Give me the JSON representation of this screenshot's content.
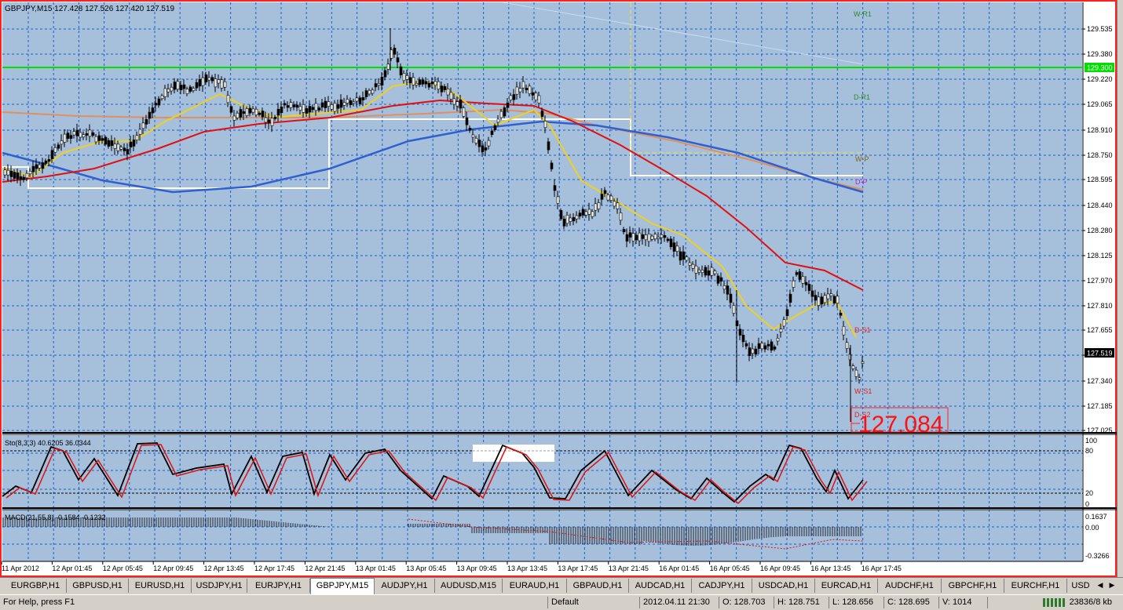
{
  "chart": {
    "header": "GBPJPY,M15  127.428 127.526 127.420 127.519",
    "big_price": "127.084",
    "price_axis": [
      "129.535",
      "129.380",
      "129.220",
      "129.065",
      "128.910",
      "128.750",
      "128.595",
      "128.440",
      "128.280",
      "128.125",
      "127.970",
      "127.810",
      "127.655",
      "127.500",
      "127.340",
      "127.185",
      "127.025"
    ],
    "highlight_green": "129.300",
    "highlight_current": "127.519",
    "time_axis": [
      "11 Apr 2012",
      "12 Apr 01:45",
      "12 Apr 05:45",
      "12 Apr 09:45",
      "12 Apr 13:45",
      "12 Apr 17:45",
      "12 Apr 21:45",
      "13 Apr 01:45",
      "13 Apr 05:45",
      "13 Apr 09:45",
      "13 Apr 13:45",
      "13 Apr 17:45",
      "13 Apr 21:45",
      "16 Apr 01:45",
      "16 Apr 05:45",
      "16 Apr 09:45",
      "16 Apr 13:45",
      "16 Apr 17:45"
    ],
    "pivot_labels": [
      "W-R1",
      "D-R1",
      "W-P",
      "D-P",
      "D-S1",
      "W-S1",
      "D-S2"
    ],
    "colors": {
      "background": "#a6bfdb",
      "grid": "#1e5ec8",
      "candle": "#000000",
      "ema_fast": "#f0d020",
      "ema_mid": "#e01010",
      "ema_slow": "#3060d0",
      "ema_orange": "#e09060",
      "green_level": "#00e000"
    }
  },
  "stochastic": {
    "label": "Sto(8,3,3) 40.6205 36.0344",
    "levels": [
      "100",
      "80",
      "20",
      "0"
    ]
  },
  "macd": {
    "label": "MACD(21,55,8) -0.1584 -0.1232",
    "levels": [
      "0.1637",
      "0.00",
      "-0.3266"
    ]
  },
  "tabs": [
    "EURGBP,H1",
    "GBPUSD,H1",
    "EURUSD,H1",
    "USDJPY,H1",
    "EURJPY,H1",
    "GBPJPY,M15",
    "AUDJPY,H1",
    "AUDUSD,M15",
    "EURAUD,H1",
    "GBPAUD,H1",
    "AUDCAD,H1",
    "CADJPY,H1",
    "USDCAD,H1",
    "EURCAD,H1",
    "AUDCHF,H1",
    "GBPCHF,H1",
    "EURCHF,H1",
    "USD"
  ],
  "active_tab": "GBPJPY,M15",
  "status": {
    "help": "For Help, press F1",
    "profile": "Default",
    "datetime": "2012.04.11 21:30",
    "open": "O: 128.703",
    "high": "H: 128.751",
    "low": "L: 128.656",
    "close": "C: 128.695",
    "volume": "V: 1014",
    "traffic": "23836/8 kb"
  }
}
